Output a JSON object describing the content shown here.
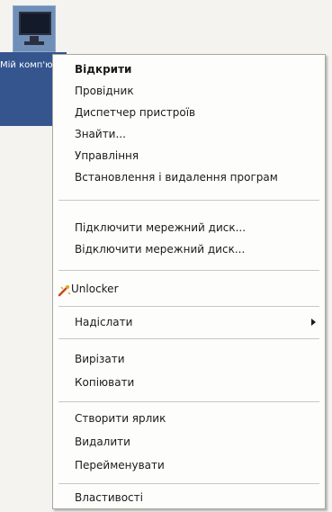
{
  "desktop_icon": {
    "label": "Мій комп'ютер",
    "icon": "computer-monitor-icon"
  },
  "context_menu": {
    "items": [
      {
        "label": "Відкрити",
        "bold": true
      },
      {
        "label": "Провідник"
      },
      {
        "label": "Диспетчер пристроїв"
      },
      {
        "label": "Знайти..."
      },
      {
        "label": "Управління"
      },
      {
        "label": "Встановлення і видалення програм"
      },
      {
        "label": "Підключити мережний диск..."
      },
      {
        "label": "Відключити мережний диск..."
      },
      {
        "label": "Unlocker",
        "icon": "unlocker-wand-icon"
      },
      {
        "label": "Надіслати",
        "submenu": true,
        "icon": "submenu-arrow-icon"
      },
      {
        "label": "Вирізати"
      },
      {
        "label": "Копіювати"
      },
      {
        "label": "Створити ярлик"
      },
      {
        "label": "Видалити"
      },
      {
        "label": "Перейменувати"
      },
      {
        "label": "Властивості"
      }
    ]
  }
}
